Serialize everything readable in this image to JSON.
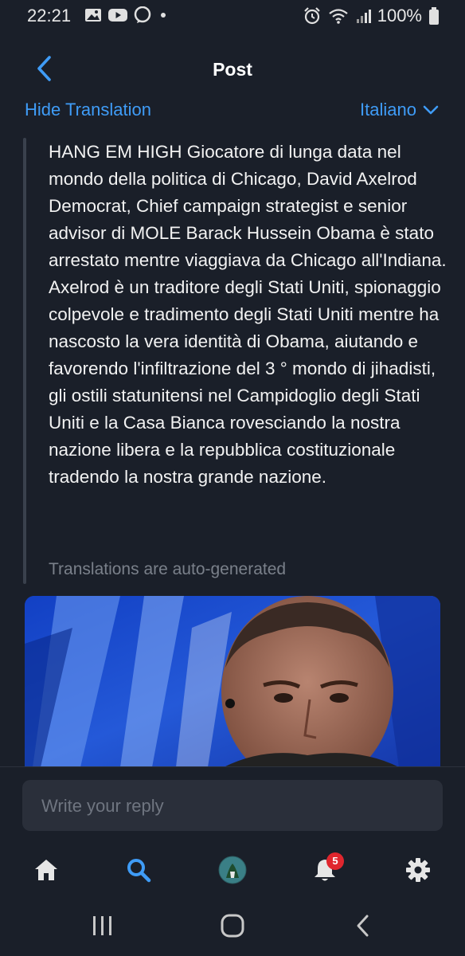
{
  "status_bar": {
    "time": "22:21",
    "battery": "100%",
    "left_icons": [
      "gallery-icon",
      "youtube-icon",
      "messenger-icon",
      "dot-icon"
    ],
    "right_icons": [
      "alarm-icon",
      "wifi-icon",
      "signal-icon",
      "battery-icon"
    ]
  },
  "header": {
    "title": "Post",
    "back_icon": "chevron-left-icon"
  },
  "translation": {
    "hide_label": "Hide Translation",
    "language": "Italiano",
    "language_icon": "chevron-down-icon",
    "note": "Translations are auto-generated"
  },
  "post": {
    "text": "HANG EM HIGH Giocatore di lunga data nel mondo della politica di Chicago, David Axelrod Democrat, Chief campaign strategist e senior advisor di MOLE Barack Hussein Obama è stato arrestato mentre viaggiava da Chicago all'Indiana. Axelrod è un traditore degli Stati Uniti, spionaggio colpevole e tradimento degli Stati Uniti mentre ha nascosto la vera identità di Obama, aiutando e favorendo l'infiltrazione del 3 ° mondo di jihadisti, gli ostili statunitensi nel Campidoglio degli Stati Uniti e la Casa Bianca rovesciando la nostra nazione libera e la repubblica costituzionale tradendo la nostra grande nazione."
  },
  "reply": {
    "placeholder": "Write your reply"
  },
  "tab_bar": {
    "items": [
      {
        "icon": "home-icon"
      },
      {
        "icon": "search-icon",
        "active": true
      },
      {
        "icon": "avatar"
      },
      {
        "icon": "bell-icon",
        "badge": "5"
      },
      {
        "icon": "gear-icon"
      }
    ]
  },
  "colors": {
    "background": "#1a1f29",
    "accent": "#3f9cf7",
    "badge": "#e0262e",
    "muted_text": "#7a808a",
    "input_bg": "#2a2f3a"
  }
}
